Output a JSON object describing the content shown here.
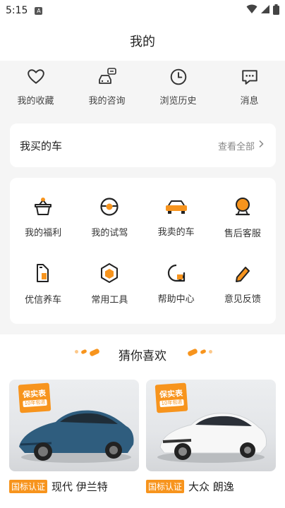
{
  "status": {
    "time": "5:15",
    "badge": "A"
  },
  "header": {
    "title": "我的"
  },
  "quick": [
    {
      "icon": "heart-icon",
      "label": "我的收藏"
    },
    {
      "icon": "chat-car-icon",
      "label": "我的咨询"
    },
    {
      "icon": "clock-icon",
      "label": "浏览历史"
    },
    {
      "icon": "message-icon",
      "label": "消息"
    }
  ],
  "mycar": {
    "title": "我买的车",
    "more": "查看全部"
  },
  "services": [
    {
      "icon": "gift-basket-icon",
      "label": "我的福利"
    },
    {
      "icon": "steering-wheel-icon",
      "label": "我的试驾"
    },
    {
      "icon": "car-sell-icon",
      "label": "我卖的车"
    },
    {
      "icon": "service-agent-icon",
      "label": "售后客服"
    },
    {
      "icon": "oil-can-icon",
      "label": "优信养车"
    },
    {
      "icon": "toolbox-icon",
      "label": "常用工具"
    },
    {
      "icon": "help-bubble-icon",
      "label": "帮助中心"
    },
    {
      "icon": "feedback-pen-icon",
      "label": "意见反馈"
    }
  ],
  "guess": {
    "title": "猜你喜欢"
  },
  "cars": [
    {
      "badge_top": "保实表",
      "badge_bottom": "10年包退",
      "tag": "国标认证",
      "name": "现代 伊兰特",
      "color": "#2f5d7e"
    },
    {
      "badge_top": "保实表",
      "badge_bottom": "10年包退",
      "tag": "国标认证",
      "name": "大众 朗逸",
      "color": "#f4f4f4"
    }
  ],
  "colors": {
    "accent": "#f7941d",
    "text": "#222222",
    "muted": "#888888"
  }
}
